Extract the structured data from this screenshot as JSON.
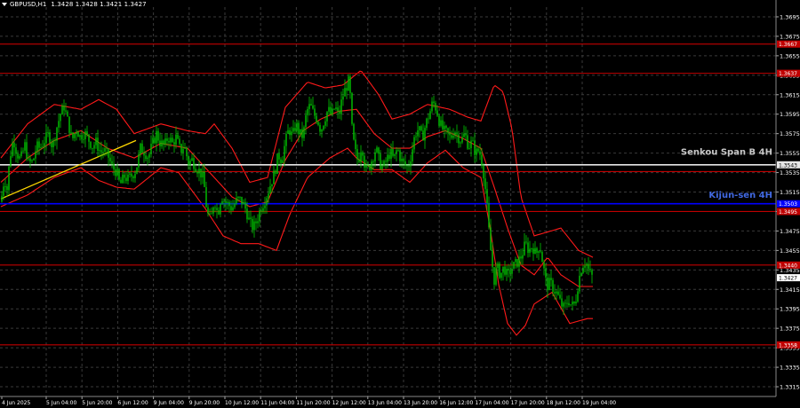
{
  "window": {
    "symbol_label": "GBPUSD,H1",
    "ohlc_label": "1.3428 1.3428 1.3421 1.3427"
  },
  "colors": {
    "background": "#000000",
    "grid": "#3a3a3a",
    "candle": "#00c800",
    "band": "#ff1a1a",
    "level": "#c00000",
    "kijun_line": "#0000ff",
    "kijun_label": "#4169e1",
    "senkou_line": "#e6e6e6",
    "senkou_label": "#c8c8c8",
    "trend": "#ffd700",
    "axis_text": "#ffffff"
  },
  "chart_data": {
    "type": "candlestick",
    "symbol": "GBPUSD",
    "timeframe": "H1",
    "ylim": [
      1.3305,
      1.3705
    ],
    "y_ticks": [
      "1.3695",
      "1.3675",
      "1.3655",
      "1.3635",
      "1.3615",
      "1.3595",
      "1.3575",
      "1.3555",
      "1.3535",
      "1.3515",
      "1.3495",
      "1.3475",
      "1.3455",
      "1.3435",
      "1.3415",
      "1.3395",
      "1.3375",
      "1.3355",
      "1.3335",
      "1.3315"
    ],
    "x_ticks": [
      "4 Jun 2025",
      "5 Jun 04:00",
      "5 Jun 20:00",
      "6 Jun 12:00",
      "9 Jun 04:00",
      "9 Jun 20:00",
      "10 Jun 12:00",
      "11 Jun 04:00",
      "11 Jun 20:00",
      "12 Jun 12:00",
      "13 Jun 04:00",
      "13 Jun 20:00",
      "16 Jun 12:00",
      "17 Jun 04:00",
      "17 Jun 20:00",
      "18 Jun 12:00",
      "19 Jun 04:00"
    ],
    "grid": true,
    "horizontal_levels": [
      {
        "value": 1.3667,
        "label": "1.3667",
        "kind": "level"
      },
      {
        "value": 1.3637,
        "label": "1.3637",
        "kind": "level"
      },
      {
        "value": 1.3543,
        "label": "1.3543",
        "kind": "senkou"
      },
      {
        "value": 1.3536,
        "label": "",
        "kind": "level"
      },
      {
        "value": 1.3503,
        "label": "1.3503",
        "kind": "kijun"
      },
      {
        "value": 1.3495,
        "label": "1.3495",
        "kind": "level"
      },
      {
        "value": 1.344,
        "label": "1.3440",
        "kind": "level"
      },
      {
        "value": 1.3358,
        "label": "1.3358",
        "kind": "level"
      }
    ],
    "current_price": {
      "value": 1.3427,
      "label": "1.3427"
    },
    "annotations": [
      {
        "text": "Senkou Span B 4H",
        "value": 1.3556,
        "kind": "senkou"
      },
      {
        "text": "Kijun-sen 4H",
        "value": 1.3512,
        "kind": "kijun"
      }
    ],
    "trend_line": {
      "from": [
        0,
        1.3508
      ],
      "to": [
        152,
        1.3568
      ]
    },
    "price_path": [
      [
        0,
        1.3505
      ],
      [
        4,
        1.353
      ],
      [
        7,
        1.3518
      ],
      [
        10,
        1.355
      ],
      [
        14,
        1.357
      ],
      [
        18,
        1.3555
      ],
      [
        22,
        1.3548
      ],
      [
        27,
        1.3563
      ],
      [
        31,
        1.3545
      ],
      [
        36,
        1.3546
      ],
      [
        40,
        1.3562
      ],
      [
        44,
        1.356
      ],
      [
        49,
        1.3568
      ],
      [
        54,
        1.3575
      ],
      [
        58,
        1.3561
      ],
      [
        63,
        1.3582
      ],
      [
        67,
        1.3595
      ],
      [
        71,
        1.3603
      ],
      [
        76,
        1.3585
      ],
      [
        80,
        1.3568
      ],
      [
        85,
        1.358
      ],
      [
        89,
        1.3572
      ],
      [
        94,
        1.3576
      ],
      [
        98,
        1.357
      ],
      [
        103,
        1.3562
      ],
      [
        107,
        1.3566
      ],
      [
        112,
        1.3556
      ],
      [
        116,
        1.3558
      ],
      [
        121,
        1.3551
      ],
      [
        125,
        1.3541
      ],
      [
        130,
        1.3536
      ],
      [
        134,
        1.3522
      ],
      [
        139,
        1.3531
      ],
      [
        143,
        1.3528
      ],
      [
        148,
        1.3533
      ],
      [
        152,
        1.3538
      ],
      [
        157,
        1.356
      ],
      [
        161,
        1.3557
      ],
      [
        166,
        1.3551
      ],
      [
        170,
        1.3563
      ],
      [
        175,
        1.3575
      ],
      [
        179,
        1.3566
      ],
      [
        184,
        1.3562
      ],
      [
        188,
        1.3572
      ],
      [
        193,
        1.3565
      ],
      [
        197,
        1.3571
      ],
      [
        202,
        1.3557
      ],
      [
        206,
        1.3563
      ],
      [
        211,
        1.3545
      ],
      [
        215,
        1.3548
      ],
      [
        220,
        1.354
      ],
      [
        224,
        1.3536
      ],
      [
        228,
        1.3528
      ],
      [
        232,
        1.3493
      ],
      [
        236,
        1.3485
      ],
      [
        240,
        1.3508
      ],
      [
        244,
        1.3492
      ],
      [
        248,
        1.3512
      ],
      [
        252,
        1.3505
      ],
      [
        256,
        1.3502
      ],
      [
        260,
        1.3498
      ],
      [
        264,
        1.3505
      ],
      [
        268,
        1.3508
      ],
      [
        272,
        1.3504
      ],
      [
        276,
        1.3496
      ],
      [
        280,
        1.3483
      ],
      [
        284,
        1.3478
      ],
      [
        288,
        1.3486
      ],
      [
        292,
        1.3498
      ],
      [
        296,
        1.3505
      ],
      [
        300,
        1.3514
      ],
      [
        304,
        1.3525
      ],
      [
        308,
        1.3535
      ],
      [
        312,
        1.3553
      ],
      [
        316,
        1.3548
      ],
      [
        320,
        1.3566
      ],
      [
        324,
        1.358
      ],
      [
        328,
        1.3572
      ],
      [
        332,
        1.3585
      ],
      [
        336,
        1.3575
      ],
      [
        340,
        1.3572
      ],
      [
        344,
        1.3598
      ],
      [
        348,
        1.3604
      ],
      [
        352,
        1.3595
      ],
      [
        356,
        1.359
      ],
      [
        360,
        1.3578
      ],
      [
        364,
        1.359
      ],
      [
        368,
        1.36
      ],
      [
        372,
        1.3593
      ],
      [
        376,
        1.3603
      ],
      [
        380,
        1.3592
      ],
      [
        384,
        1.3612
      ],
      [
        388,
        1.3622
      ],
      [
        392,
        1.363
      ],
      [
        395,
        1.358
      ],
      [
        398,
        1.3558
      ],
      [
        402,
        1.3546
      ],
      [
        406,
        1.3565
      ],
      [
        410,
        1.3538
      ],
      [
        414,
        1.354
      ],
      [
        418,
        1.355
      ],
      [
        422,
        1.356
      ],
      [
        426,
        1.3545
      ],
      [
        430,
        1.354
      ],
      [
        434,
        1.3548
      ],
      [
        438,
        1.3556
      ],
      [
        442,
        1.3548
      ],
      [
        446,
        1.356
      ],
      [
        450,
        1.3548
      ],
      [
        454,
        1.3543
      ],
      [
        458,
        1.354
      ],
      [
        462,
        1.3555
      ],
      [
        466,
        1.3575
      ],
      [
        470,
        1.358
      ],
      [
        474,
        1.357
      ],
      [
        478,
        1.3585
      ],
      [
        482,
        1.3595
      ],
      [
        486,
        1.3608
      ],
      [
        490,
        1.36
      ],
      [
        494,
        1.3585
      ],
      [
        498,
        1.3578
      ],
      [
        502,
        1.3575
      ],
      [
        506,
        1.357
      ],
      [
        510,
        1.358
      ],
      [
        514,
        1.3572
      ],
      [
        518,
        1.3568
      ],
      [
        522,
        1.3575
      ],
      [
        526,
        1.3562
      ],
      [
        530,
        1.3566
      ],
      [
        534,
        1.3555
      ],
      [
        538,
        1.3558
      ],
      [
        542,
        1.3543
      ],
      [
        546,
        1.351
      ],
      [
        549,
        1.3475
      ],
      [
        552,
        1.3445
      ],
      [
        555,
        1.3425
      ],
      [
        558,
        1.3438
      ],
      [
        562,
        1.343
      ],
      [
        566,
        1.3438
      ],
      [
        570,
        1.3428
      ],
      [
        574,
        1.3436
      ],
      [
        578,
        1.344
      ],
      [
        582,
        1.3444
      ],
      [
        586,
        1.345
      ],
      [
        590,
        1.3462
      ],
      [
        594,
        1.3455
      ],
      [
        598,
        1.346
      ],
      [
        602,
        1.345
      ],
      [
        606,
        1.3462
      ],
      [
        610,
        1.344
      ],
      [
        614,
        1.3418
      ],
      [
        618,
        1.3422
      ],
      [
        622,
        1.3415
      ],
      [
        626,
        1.341
      ],
      [
        630,
        1.34
      ],
      [
        634,
        1.3395
      ],
      [
        638,
        1.3405
      ],
      [
        642,
        1.3398
      ],
      [
        646,
        1.34
      ],
      [
        650,
        1.3425
      ],
      [
        654,
        1.344
      ],
      [
        658,
        1.3444
      ],
      [
        662,
        1.3432
      ],
      [
        666,
        1.3427
      ]
    ],
    "upper_band": [
      [
        0,
        1.355
      ],
      [
        30,
        1.3585
      ],
      [
        60,
        1.3605
      ],
      [
        90,
        1.36
      ],
      [
        110,
        1.361
      ],
      [
        130,
        1.36
      ],
      [
        150,
        1.3575
      ],
      [
        180,
        1.3585
      ],
      [
        210,
        1.3578
      ],
      [
        230,
        1.3575
      ],
      [
        240,
        1.3585
      ],
      [
        260,
        1.356
      ],
      [
        280,
        1.3525
      ],
      [
        300,
        1.353
      ],
      [
        320,
        1.3602
      ],
      [
        345,
        1.3628
      ],
      [
        365,
        1.3622
      ],
      [
        385,
        1.3625
      ],
      [
        405,
        1.364
      ],
      [
        425,
        1.3615
      ],
      [
        440,
        1.359
      ],
      [
        460,
        1.3595
      ],
      [
        480,
        1.3605
      ],
      [
        505,
        1.36
      ],
      [
        525,
        1.3592
      ],
      [
        540,
        1.3588
      ],
      [
        555,
        1.3625
      ],
      [
        565,
        1.3618
      ],
      [
        575,
        1.358
      ],
      [
        585,
        1.351
      ],
      [
        600,
        1.347
      ],
      [
        630,
        1.3478
      ],
      [
        650,
        1.3455
      ],
      [
        666,
        1.3448
      ]
    ],
    "middle_band": [
      [
        0,
        1.3525
      ],
      [
        30,
        1.355
      ],
      [
        60,
        1.3568
      ],
      [
        90,
        1.3578
      ],
      [
        120,
        1.356
      ],
      [
        150,
        1.355
      ],
      [
        180,
        1.3565
      ],
      [
        210,
        1.356
      ],
      [
        230,
        1.354
      ],
      [
        260,
        1.351
      ],
      [
        280,
        1.35
      ],
      [
        300,
        1.3505
      ],
      [
        320,
        1.3548
      ],
      [
        340,
        1.3578
      ],
      [
        360,
        1.359
      ],
      [
        380,
        1.3598
      ],
      [
        400,
        1.36
      ],
      [
        420,
        1.3575
      ],
      [
        440,
        1.356
      ],
      [
        460,
        1.356
      ],
      [
        480,
        1.3572
      ],
      [
        500,
        1.3578
      ],
      [
        520,
        1.357
      ],
      [
        540,
        1.356
      ],
      [
        555,
        1.352
      ],
      [
        570,
        1.3478
      ],
      [
        585,
        1.344
      ],
      [
        600,
        1.343
      ],
      [
        615,
        1.3448
      ],
      [
        630,
        1.343
      ],
      [
        650,
        1.3418
      ],
      [
        666,
        1.3418
      ]
    ],
    "lower_band": [
      [
        0,
        1.35
      ],
      [
        30,
        1.3512
      ],
      [
        60,
        1.353
      ],
      [
        90,
        1.354
      ],
      [
        110,
        1.3527
      ],
      [
        130,
        1.352
      ],
      [
        150,
        1.3518
      ],
      [
        180,
        1.354
      ],
      [
        200,
        1.3535
      ],
      [
        230,
        1.3498
      ],
      [
        250,
        1.347
      ],
      [
        270,
        1.3462
      ],
      [
        290,
        1.3462
      ],
      [
        310,
        1.3455
      ],
      [
        325,
        1.3492
      ],
      [
        345,
        1.353
      ],
      [
        370,
        1.355
      ],
      [
        390,
        1.356
      ],
      [
        400,
        1.355
      ],
      [
        420,
        1.3538
      ],
      [
        440,
        1.3538
      ],
      [
        460,
        1.3525
      ],
      [
        480,
        1.3545
      ],
      [
        500,
        1.3558
      ],
      [
        520,
        1.354
      ],
      [
        540,
        1.353
      ],
      [
        550,
        1.348
      ],
      [
        560,
        1.342
      ],
      [
        570,
        1.338
      ],
      [
        580,
        1.3368
      ],
      [
        590,
        1.3378
      ],
      [
        600,
        1.34
      ],
      [
        620,
        1.3412
      ],
      [
        640,
        1.338
      ],
      [
        660,
        1.3385
      ],
      [
        666,
        1.3385
      ]
    ]
  }
}
